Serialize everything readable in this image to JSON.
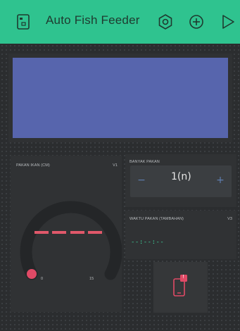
{
  "header": {
    "title": "Auto Fish Feeder",
    "background": "#2fc38f",
    "icons": [
      "project-icon",
      "settings-icon",
      "add-widget-icon",
      "play-icon"
    ]
  },
  "terminal": {
    "screen_color": "#5765ad"
  },
  "gauge": {
    "label": "PAKAN IKAN (CM)",
    "pin": "V1",
    "value_text": "- - - -",
    "min": "0",
    "max": "15",
    "value_color": "#e0586a",
    "knob_color": "#e04a66"
  },
  "stepper": {
    "label": "BANYAK PAKAN",
    "minus": "−",
    "plus": "+",
    "value": "1(n)"
  },
  "value_display": {
    "label": "WAKTU PAKAN (TAMBAHAN)",
    "pin": "V3",
    "value": "--:--:--",
    "value_color": "#3fd89e"
  },
  "notification": {
    "badge": "!",
    "badge_color": "#e04a66"
  }
}
